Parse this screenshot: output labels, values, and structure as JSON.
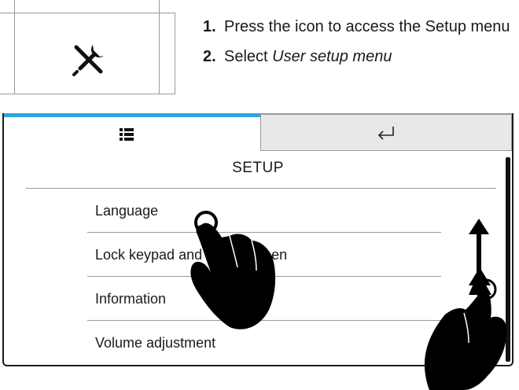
{
  "tool_panel": {
    "icon": "wrench-screwdriver-icon"
  },
  "instructions": {
    "step1_number": "1.",
    "step1_text": "Press the icon to access the Setup menu",
    "step2_number": "2.",
    "step2_prefix": "Select ",
    "step2_emphasis": "User setup menu"
  },
  "screen": {
    "tabs": {
      "list_icon": "list-icon",
      "back_icon": "return-arrow-icon"
    },
    "title": "SETUP",
    "menu_items": [
      {
        "label": "Language"
      },
      {
        "label": "Lock keypad and touch screen"
      },
      {
        "label": "Information"
      },
      {
        "label": "Volume adjustment"
      }
    ]
  },
  "colors": {
    "accent": "#2aa6e0",
    "tab_inactive": "#e8e8e8",
    "divider": "#9a9a9a"
  }
}
